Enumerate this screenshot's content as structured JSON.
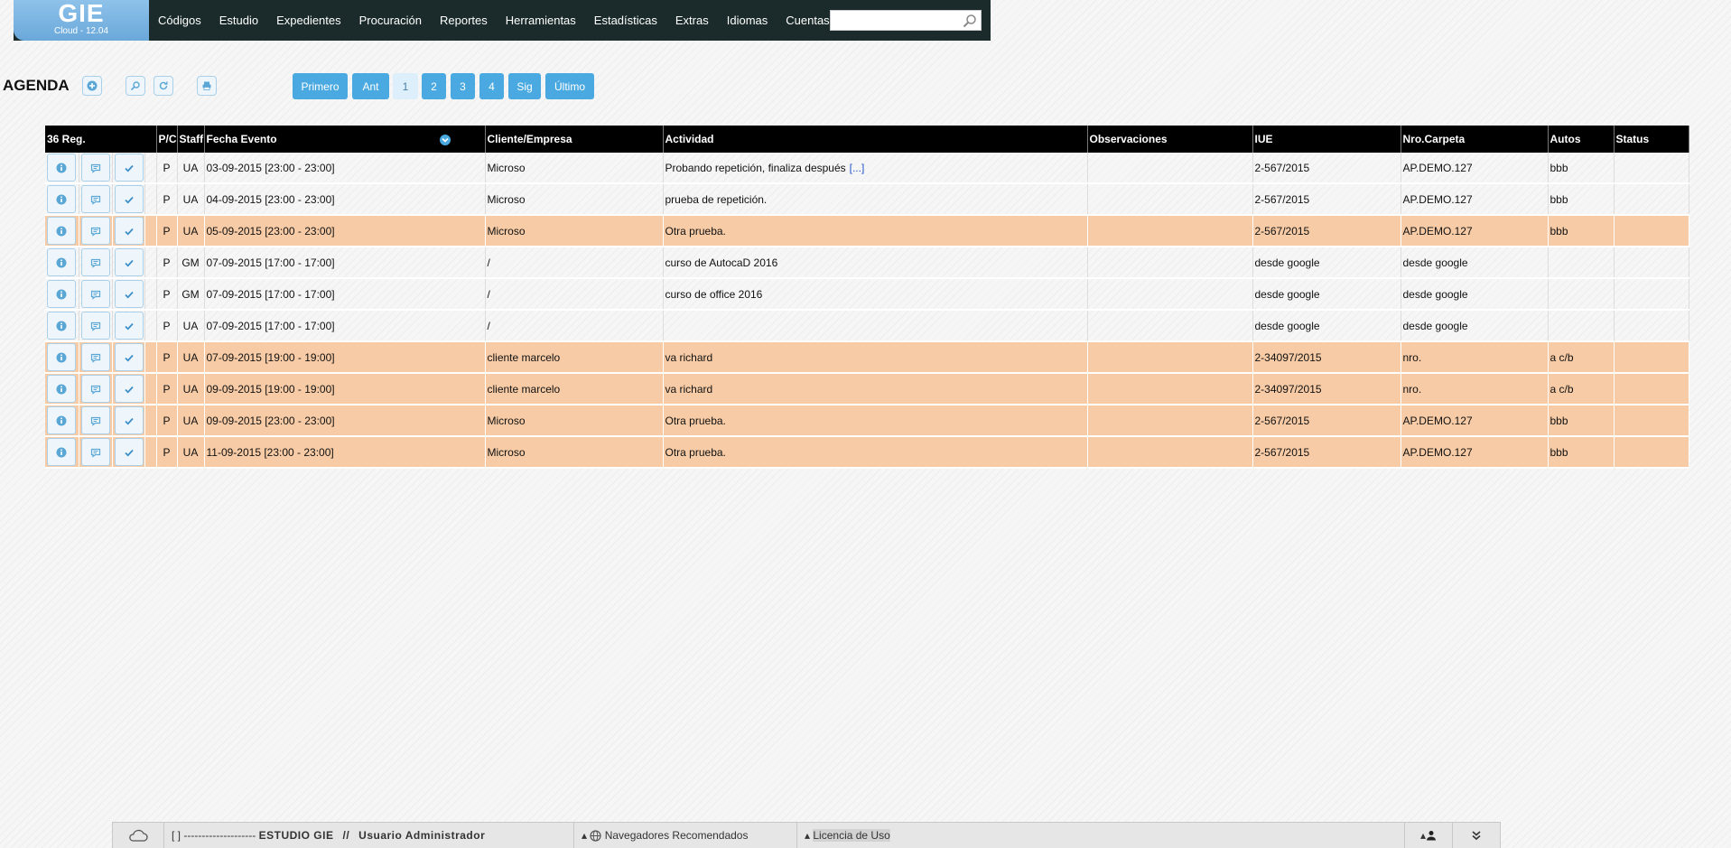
{
  "app": {
    "name": "GIE",
    "version": "Cloud  - 12.04"
  },
  "menu": [
    "Códigos",
    "Estudio",
    "Expedientes",
    "Procuración",
    "Reportes",
    "Herramientas",
    "Estadísticas",
    "Extras",
    "Idiomas",
    "Cuentas"
  ],
  "search": {
    "value": "",
    "placeholder": ""
  },
  "page": {
    "title": "AGENDA"
  },
  "pagination": {
    "first": "Primero",
    "prev": "Ant",
    "pages": [
      "1",
      "2",
      "3",
      "4"
    ],
    "next": "Sig",
    "last": "Último"
  },
  "table": {
    "count_label": "36 Reg.",
    "headers": {
      "pc": "P/C",
      "staff": "Staff",
      "fecha": "Fecha Evento",
      "cliente": "Cliente/Empresa",
      "actividad": "Actividad",
      "obs": "Observaciones",
      "iue": "IUE",
      "carpeta": "Nro.Carpeta",
      "autos": "Autos",
      "status": "Status"
    },
    "more_link": "[...]",
    "rows": [
      {
        "pc": "P",
        "staff": "UA",
        "fecha": "03-09-2015  [23:00 - 23:00]",
        "cliente": "Microso",
        "actividad": "Probando repetición, finaliza después",
        "obs": "",
        "iue": "2-567/2015",
        "carpeta": "AP.DEMO.127",
        "autos": "bbb",
        "status": ""
      },
      {
        "pc": "P",
        "staff": "UA",
        "fecha": "04-09-2015  [23:00 - 23:00]",
        "cliente": "Microso",
        "actividad": "prueba de repetición.",
        "obs": "",
        "iue": "2-567/2015",
        "carpeta": "AP.DEMO.127",
        "autos": "bbb",
        "status": ""
      },
      {
        "pc": "P",
        "staff": "UA",
        "fecha": "05-09-2015  [23:00 - 23:00]",
        "cliente": "Microso",
        "actividad": "Otra prueba.",
        "obs": "",
        "iue": "2-567/2015",
        "carpeta": "AP.DEMO.127",
        "autos": "bbb",
        "status": ""
      },
      {
        "pc": "P",
        "staff": "GM",
        "fecha": "07-09-2015  [17:00 - 17:00]",
        "cliente": "/",
        "actividad": "curso de AutocaD 2016",
        "obs": "",
        "iue": "desde google",
        "carpeta": "desde google",
        "autos": "",
        "status": ""
      },
      {
        "pc": "P",
        "staff": "GM",
        "fecha": "07-09-2015  [17:00 - 17:00]",
        "cliente": "/",
        "actividad": "curso de office 2016",
        "obs": "",
        "iue": "desde google",
        "carpeta": "desde google",
        "autos": "",
        "status": ""
      },
      {
        "pc": "P",
        "staff": "UA",
        "fecha": "07-09-2015  [17:00 - 17:00]",
        "cliente": "/",
        "actividad": "",
        "obs": "",
        "iue": "desde google",
        "carpeta": "desde google",
        "autos": "",
        "status": ""
      },
      {
        "pc": "P",
        "staff": "UA",
        "fecha": "07-09-2015  [19:00 - 19:00]",
        "cliente": "cliente marcelo",
        "actividad": "va richard",
        "obs": "",
        "iue": "2-34097/2015",
        "carpeta": "nro.",
        "autos": "a c/b",
        "status": ""
      },
      {
        "pc": "P",
        "staff": "UA",
        "fecha": "09-09-2015  [19:00 - 19:00]",
        "cliente": "cliente marcelo",
        "actividad": "va richard",
        "obs": "",
        "iue": "2-34097/2015",
        "carpeta": "nro.",
        "autos": "a c/b",
        "status": ""
      },
      {
        "pc": "P",
        "staff": "UA",
        "fecha": "09-09-2015  [23:00 - 23:00]",
        "cliente": "Microso",
        "actividad": "Otra prueba.",
        "obs": "",
        "iue": "2-567/2015",
        "carpeta": "AP.DEMO.127",
        "autos": "bbb",
        "status": ""
      },
      {
        "pc": "P",
        "staff": "UA",
        "fecha": "11-09-2015  [23:00 - 23:00]",
        "cliente": "Microso",
        "actividad": "Otra prueba.",
        "obs": "",
        "iue": "2-567/2015",
        "carpeta": "AP.DEMO.127",
        "autos": "bbb",
        "status": ""
      }
    ]
  },
  "footer": {
    "brackets": "[ ]",
    "dashes": "--------------------",
    "studio": "ESTUDIO GIE",
    "sep": "//",
    "user": "Usuario Administrador",
    "browsers": "Navegadores Recomendados",
    "license": "Licencia de Uso"
  },
  "colors": {
    "nav_bg": "#1b2b2c",
    "logo_bg": "#78b4e2",
    "button_blue": "#4aa9e0",
    "row_highlight": "#f7cba5"
  }
}
